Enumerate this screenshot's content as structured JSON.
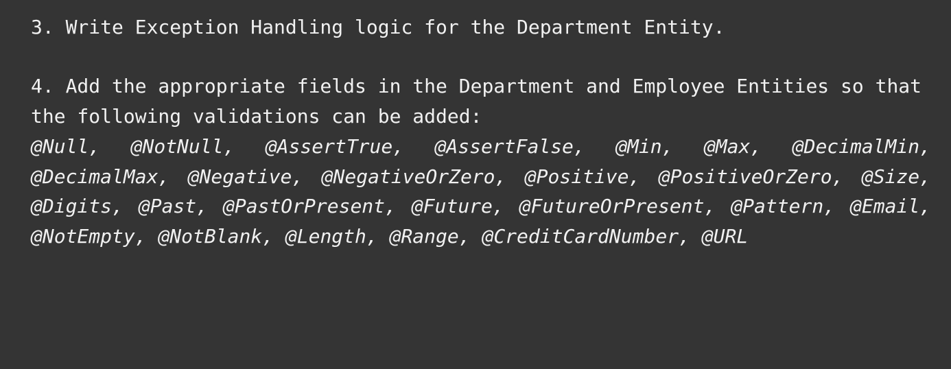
{
  "document": {
    "item_3": "3. Write Exception Handling logic for the Department Entity.",
    "item_4": "4. Add the appropriate fields in the Department and Employee Entities so that the following validations can be added:",
    "annotations": [
      "@Null,",
      "@NotNull,",
      "@AssertTrue,",
      "@AssertFalse,",
      "@Min,",
      "@Max,",
      "@DecimalMin,",
      "@DecimalMax,",
      "@Negative,",
      "@NegativeOrZero,",
      "@Positive,",
      "@PositiveOrZero,",
      "@Size,",
      "@Digits,",
      "@Past,",
      "@PastOrPresent,",
      "@Future,",
      "@FutureOrPresent,",
      "@Pattern,",
      "@Email,",
      "@NotEmpty,",
      "@NotBlank,",
      "@Length,",
      "@Range,",
      "@CreditCardNumber,",
      "@URL"
    ]
  }
}
